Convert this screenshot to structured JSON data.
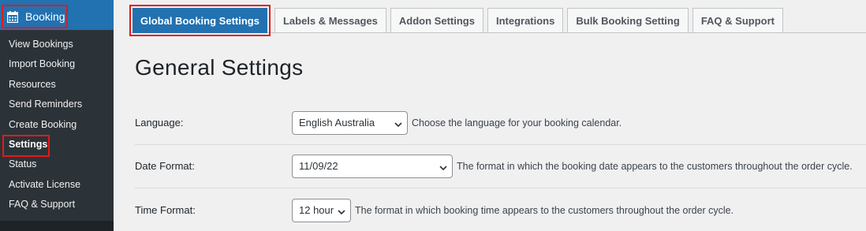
{
  "sidebar": {
    "parent_label": "Booking",
    "items": [
      {
        "label": "View Bookings"
      },
      {
        "label": "Import Booking"
      },
      {
        "label": "Resources"
      },
      {
        "label": "Send Reminders"
      },
      {
        "label": "Create Booking"
      },
      {
        "label": "Settings",
        "current": true
      },
      {
        "label": "Status"
      },
      {
        "label": "Activate License"
      },
      {
        "label": "FAQ & Support"
      }
    ]
  },
  "tabs": [
    {
      "label": "Global Booking Settings",
      "active": true
    },
    {
      "label": "Labels & Messages"
    },
    {
      "label": "Addon Settings"
    },
    {
      "label": "Integrations"
    },
    {
      "label": "Bulk Booking Setting"
    },
    {
      "label": "FAQ & Support"
    }
  ],
  "page": {
    "heading": "General Settings"
  },
  "settings": {
    "language": {
      "label": "Language:",
      "value": "English Australia",
      "description": "Choose the language for your booking calendar."
    },
    "date_format": {
      "label": "Date Format:",
      "value": "11/09/22",
      "description": "The format in which the booking date appears to the customers throughout the order cycle."
    },
    "time_format": {
      "label": "Time Format:",
      "value": "12 hour",
      "description": "The format in which booking time appears to the customers throughout the order cycle."
    }
  },
  "colors": {
    "accent": "#2271b1",
    "highlight_border": "#e01b1b",
    "sidebar_bg": "#2c3338"
  },
  "icons": {
    "booking": "calendar-icon",
    "select": "chevron-down-icon"
  }
}
